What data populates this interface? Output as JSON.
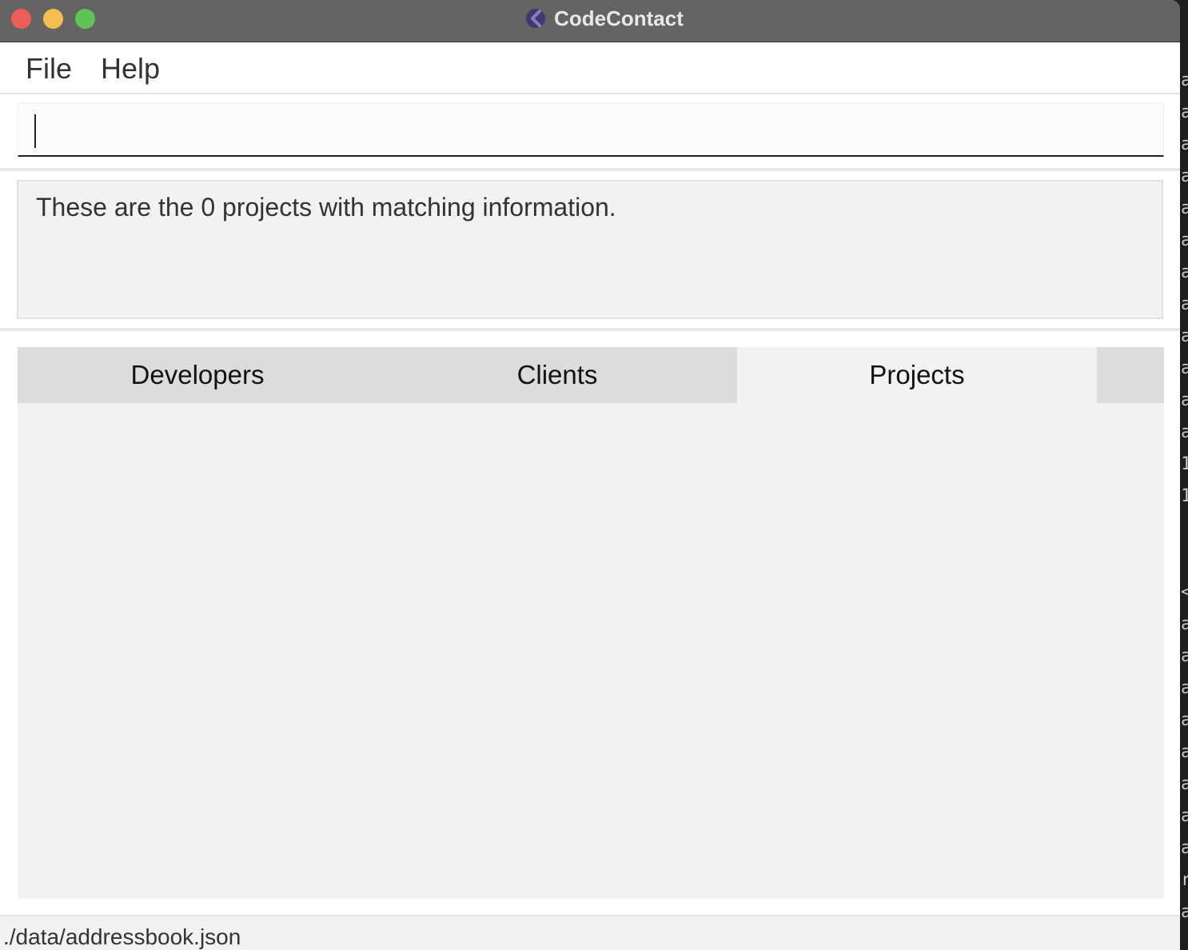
{
  "window": {
    "title": "CodeContact",
    "app_icon": "codecontact-logo"
  },
  "menubar": {
    "items": [
      {
        "label": "File"
      },
      {
        "label": "Help"
      }
    ]
  },
  "command_box": {
    "value": "",
    "placeholder": ""
  },
  "result_display": {
    "text": "These are the 0 projects with matching information."
  },
  "tabs": [
    {
      "label": "Developers",
      "selected": false
    },
    {
      "label": "Clients",
      "selected": false
    },
    {
      "label": "Projects",
      "selected": true
    }
  ],
  "status_bar": {
    "save_location": "./data/addressbook.json"
  },
  "colors": {
    "titlebar": "#646464",
    "close": "#ee5e57",
    "minimize": "#f4bf4f",
    "maximize": "#5fc454",
    "tab_inactive": "#dcdcdc",
    "tab_active": "#f2f2f2",
    "panel": "#f2f2f2"
  }
}
